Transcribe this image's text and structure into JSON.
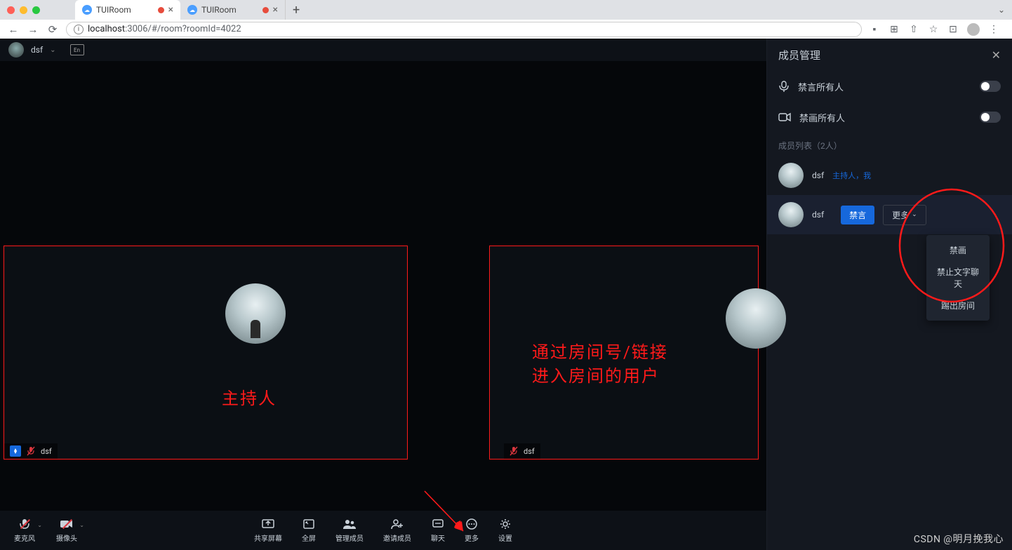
{
  "browser": {
    "tabs": [
      {
        "title": "TUIRoom",
        "recording": true
      },
      {
        "title": "TUIRoom",
        "recording": true
      }
    ],
    "url_host": "localhost",
    "url_port": ":3006",
    "url_path": "/#/room?roomId=4022"
  },
  "header": {
    "username": "dsf"
  },
  "tiles": {
    "host_label": "主持人",
    "guest_label": "通过房间号/链接\n进入房间的用户",
    "user1": "dsf",
    "user2": "dsf"
  },
  "toolbar": {
    "mic": "麦克风",
    "camera": "摄像头",
    "share": "共享屏幕",
    "fullscreen": "全屏",
    "manage": "管理成员",
    "invite": "邀请成员",
    "chat": "聊天",
    "more": "更多",
    "settings": "设置"
  },
  "panel": {
    "title": "成员管理",
    "mute_all_audio": "禁言所有人",
    "mute_all_video": "禁画所有人",
    "list_header": "成员列表（2人）",
    "members": [
      {
        "name": "dsf",
        "tag": "主持人，我"
      },
      {
        "name": "dsf",
        "tag": ""
      }
    ],
    "btn_mute": "禁言",
    "btn_more": "更多",
    "dropdown": {
      "mute_video": "禁画",
      "mute_chat": "禁止文字聊天",
      "kick": "踢出房间"
    }
  },
  "watermark": "CSDN @明月挽我心"
}
